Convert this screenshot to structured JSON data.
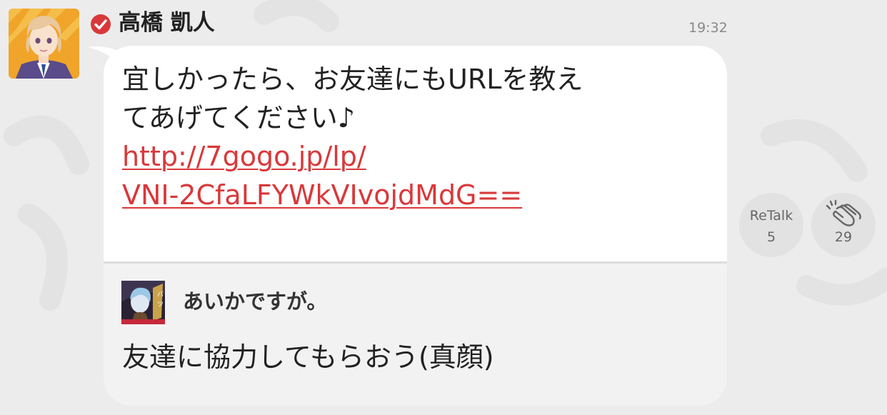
{
  "post": {
    "sender_name": "高橋 凱人",
    "timestamp": "19:32",
    "message_lines": [
      "宜しかったら、お友達にもURLを教え",
      "てあげてください♪"
    ],
    "link": {
      "line1": "http://7gogo.jp/lp/",
      "line2": "VNI-2CfaLFYWkVIvojdMdG=="
    }
  },
  "quoted": {
    "name": "あいかですが。",
    "text": "友達に協力してもらおう(真顔)"
  },
  "actions": {
    "retalk_label": "ReTalk",
    "retalk_count": "5",
    "clap_count": "29"
  },
  "icons": {
    "verified": "verified-check-icon",
    "clap": "clap-hands-icon"
  },
  "colors": {
    "accent_red": "#d9383a",
    "background": "#ececec",
    "bubble": "#ffffff",
    "quote_bg": "#f2f2f2"
  }
}
